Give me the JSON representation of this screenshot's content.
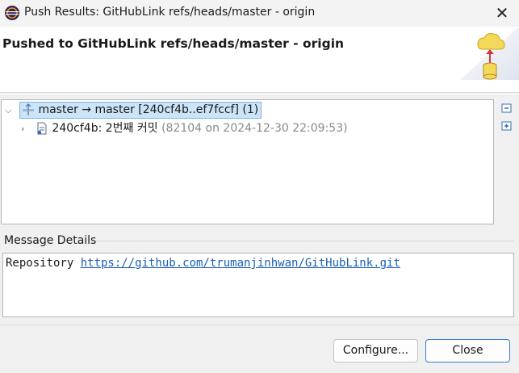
{
  "window": {
    "title": "Push Results: GitHubLink refs/heads/master - origin",
    "close_glyph": "✕"
  },
  "banner": {
    "heading": "Pushed to GitHubLink refs/heads/master - origin",
    "icon": "push-to-cloud-icon"
  },
  "tree": {
    "ref_row": {
      "label": "master → master [240cf4b..ef7fccf] (1)",
      "icon": "branch-icon",
      "expanded": true,
      "selected": true
    },
    "commit_row": {
      "label": "240cf4b: 2번째 커밋",
      "meta": "(82104 on 2024-12-30 22:09:53)",
      "icon": "commit-icon",
      "expanded": false
    }
  },
  "side_buttons": {
    "collapse_icon": "collapse-all-icon",
    "expand_icon": "expand-all-icon"
  },
  "message": {
    "label": "Message Details",
    "prefix": "Repository ",
    "link": "https://github.com/trumanjinhwan/GitHubLink.git"
  },
  "buttons": {
    "configure": "Configure...",
    "close": "Close"
  },
  "colors": {
    "selection_bg": "#cce4f7",
    "selection_border": "#7db2e8",
    "link": "#1a5fb4",
    "default_button_border": "#3d7bd9"
  }
}
